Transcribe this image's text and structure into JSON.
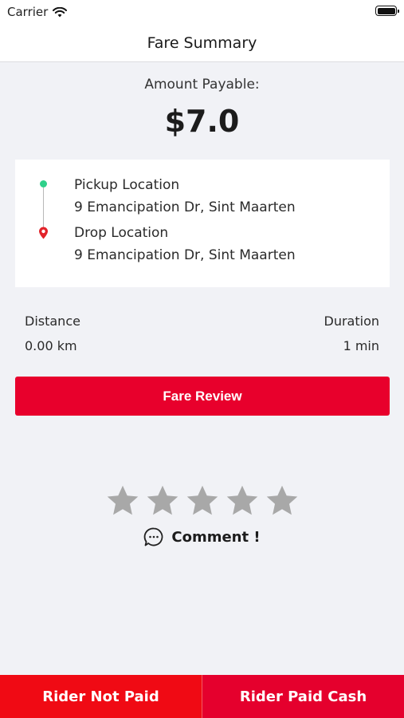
{
  "status_bar": {
    "carrier": "Carrier",
    "wifi_icon": "wifi-icon",
    "battery_icon": "battery-icon"
  },
  "nav": {
    "title": "Fare Summary"
  },
  "fare": {
    "label": "Amount Payable:",
    "amount": "$7.0"
  },
  "trip": {
    "pickup_title": "Pickup Location",
    "pickup_address": "9 Emancipation Dr, Sint Maarten",
    "drop_title": "Drop Location",
    "drop_address": "9 Emancipation Dr, Sint Maarten"
  },
  "stats": {
    "distance_label": "Distance",
    "distance_value": "0.00 km",
    "duration_label": "Duration",
    "duration_value": "1 min"
  },
  "actions": {
    "fare_review": "Fare Review",
    "comment": "Comment !",
    "rider_not_paid": "Rider Not Paid",
    "rider_paid_cash": "Rider Paid Cash"
  },
  "rating": {
    "value": 0,
    "max": 5
  },
  "colors": {
    "accent_red": "#e8002c",
    "pickup_green": "#2fd08a",
    "drop_red": "#e2232a",
    "star_gray": "#a8a8a8"
  }
}
